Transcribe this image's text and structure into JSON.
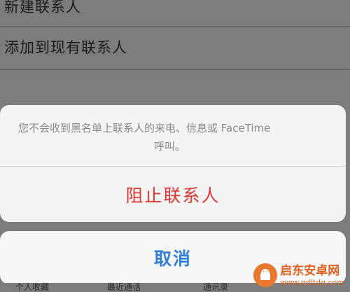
{
  "background": {
    "rows": [
      {
        "label": "新建联系人"
      },
      {
        "label": "添加到现有联系人"
      }
    ]
  },
  "action_sheet": {
    "message_line1": "您不会收到黑名单上联系人的来电、信息或 FaceTime",
    "message_line2": "呼叫。",
    "block_label": "阻止联系人",
    "cancel_label": "取消"
  },
  "tabbar": {
    "tabs": [
      {
        "label": "个人收藏"
      },
      {
        "label": "最近通话"
      },
      {
        "label": "通讯录"
      }
    ]
  },
  "watermark": {
    "title": "启东安卓网",
    "url": "www.qdltdq.com"
  },
  "colors": {
    "destructive": "#e3342f",
    "accent": "#2f7fd6",
    "watermark": "#e0621e"
  }
}
